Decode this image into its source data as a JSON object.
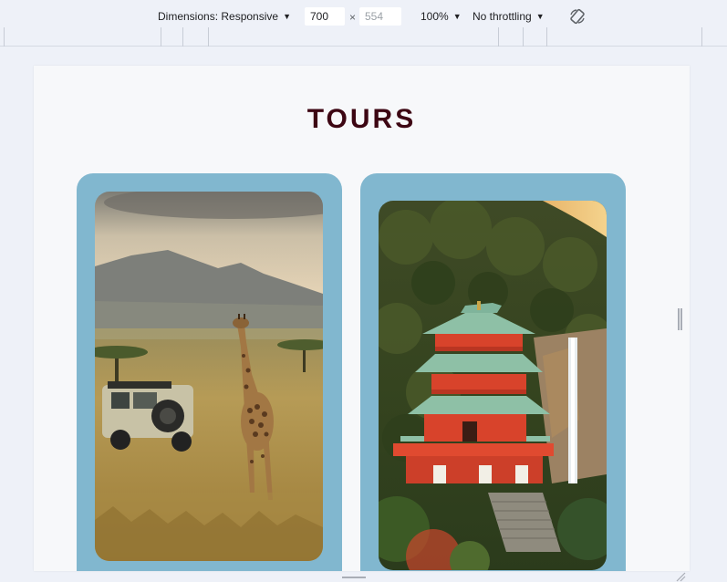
{
  "devtools": {
    "dimensions_label": "Dimensions: Responsive",
    "width_value": "700",
    "times_symbol": "×",
    "height_placeholder": "554",
    "zoom": "100%",
    "throttling": "No throttling",
    "caret_glyph": "▼",
    "rotate_icon": "rotate-icon"
  },
  "page": {
    "title": "TOURS",
    "title_color": "#3d0613",
    "card_color": "#81b7cf",
    "tours": [
      {
        "image": "safari-giraffe-photo"
      },
      {
        "image": "japanese-pagoda-waterfall-photo"
      }
    ]
  }
}
